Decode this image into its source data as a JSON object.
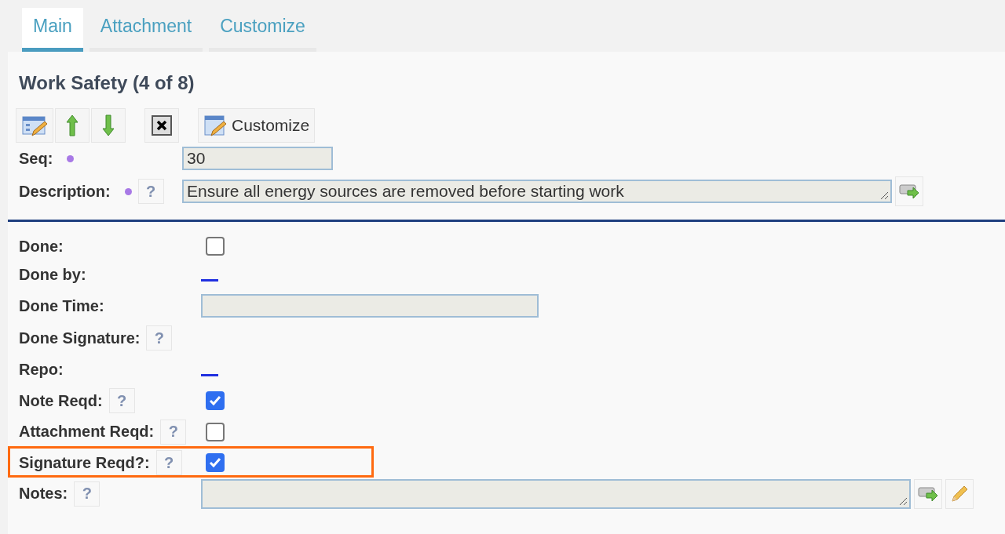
{
  "tabs": [
    {
      "label": "Main",
      "selected": true
    },
    {
      "label": "Attachment",
      "selected": false
    },
    {
      "label": "Customize",
      "selected": false
    }
  ],
  "title": "Work Safety (4 of 8)",
  "toolbar": [
    {
      "kind": "edit"
    },
    {
      "kind": "up"
    },
    {
      "kind": "down"
    },
    {
      "kind": "delete"
    },
    {
      "kind": "customize",
      "label": "Customize"
    }
  ],
  "header_fields": [
    {
      "label": "Seq:",
      "required": true,
      "kind": "input",
      "value": "30"
    },
    {
      "label": "Description:",
      "required": true,
      "help": "?",
      "kind": "textarea",
      "value": "Ensure all energy sources are removed before starting work",
      "actions": [
        {
          "kind": "go"
        }
      ]
    }
  ],
  "fields": [
    {
      "label": "Done:",
      "kind": "checkbox",
      "checked": false,
      "highlighted": false
    },
    {
      "label": "Done by:",
      "kind": "link",
      "highlighted": false
    },
    {
      "label": "Done Time:",
      "kind": "input",
      "highlighted": false
    },
    {
      "label": "Done Signature:",
      "help": "?",
      "kind": "none",
      "highlighted": false
    },
    {
      "label": "Repo:",
      "kind": "link",
      "highlighted": false
    },
    {
      "label": "Note Reqd:",
      "help": "?",
      "kind": "checkbox",
      "checked": true,
      "highlighted": false
    },
    {
      "label": "Attachment Reqd:",
      "help": "?",
      "kind": "checkbox",
      "checked": false,
      "highlighted": false
    },
    {
      "label": "Signature Reqd?:",
      "help": "?",
      "kind": "checkbox",
      "checked": true,
      "highlighted": true
    },
    {
      "label": "Notes:",
      "help": "?",
      "kind": "textarea",
      "actions": [
        {
          "kind": "go"
        },
        {
          "kind": "edit"
        }
      ],
      "highlighted": false
    }
  ]
}
